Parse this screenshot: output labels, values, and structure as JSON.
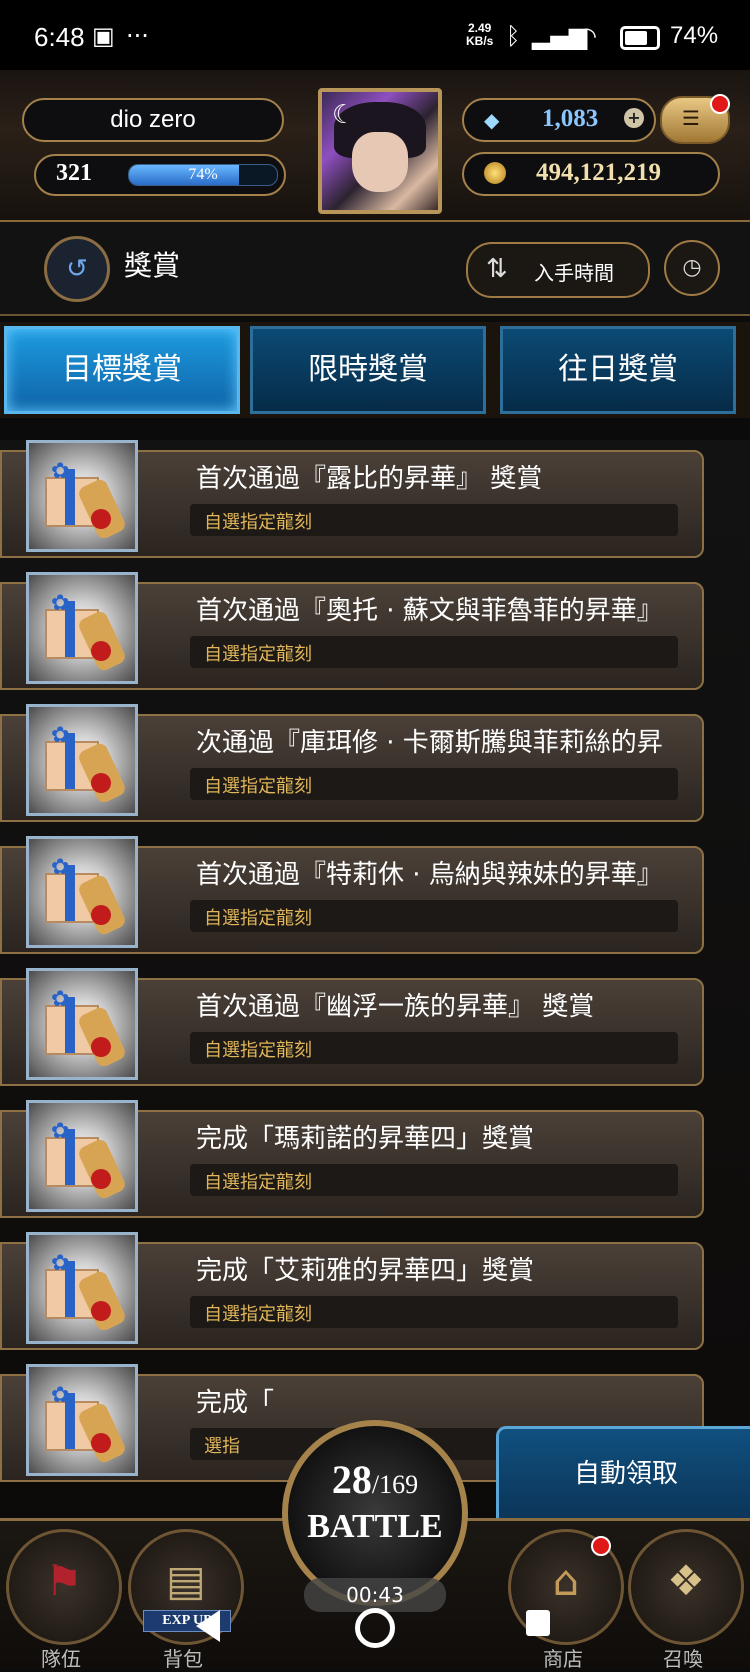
{
  "status_bar": {
    "time": "6:48",
    "speed_value": "2.49",
    "speed_unit": "KB/s",
    "battery_percent": "74%",
    "battery_level": 0.74,
    "icons": [
      "screen-record-icon",
      "more-dots-icon",
      "bluetooth-icon",
      "signal-icon",
      "wifi-icon",
      "battery-icon"
    ]
  },
  "player": {
    "name": "dio zero",
    "level": "321",
    "xp_percent_text": "74%",
    "xp_fraction": 0.74
  },
  "currency": {
    "gems": "1,083",
    "gold": "494,121,219"
  },
  "title_bar": {
    "title": "獎賞",
    "sort_label": "入手時間"
  },
  "tabs": [
    {
      "label": "目標獎賞",
      "active": true
    },
    {
      "label": "限時獎賞",
      "active": false
    },
    {
      "label": "往日獎賞",
      "active": false
    }
  ],
  "rewards": [
    {
      "title": "首次通過『露比的昇華』 獎賞",
      "subtitle": "自選指定龍刻"
    },
    {
      "title": "首次通過『奧托 · 蘇文與菲魯菲的昇華』",
      "subtitle": "自選指定龍刻"
    },
    {
      "title": "次通過『庫珥修 · 卡爾斯騰與菲莉絲的昇",
      "subtitle": "自選指定龍刻"
    },
    {
      "title": "首次通過『特莉休 · 烏納與辣妹的昇華』",
      "subtitle": "自選指定龍刻"
    },
    {
      "title": "首次通過『幽浮一族的昇華』 獎賞",
      "subtitle": "自選指定龍刻"
    },
    {
      "title": "完成「瑪莉諾的昇華四」獎賞",
      "subtitle": "自選指定龍刻"
    },
    {
      "title": "完成「艾莉雅的昇華四」獎賞",
      "subtitle": "自選指定龍刻"
    },
    {
      "title": "完成「",
      "subtitle": "選指"
    }
  ],
  "auto_claim_label": "自動領取",
  "battle": {
    "current": "28",
    "max": "169",
    "label": "BATTLE",
    "timer": "00:43"
  },
  "bottom_nav": {
    "team": "隊伍",
    "bag": "背包",
    "bag_tag": "EXP UP",
    "shop": "商店",
    "summon": "召喚"
  }
}
